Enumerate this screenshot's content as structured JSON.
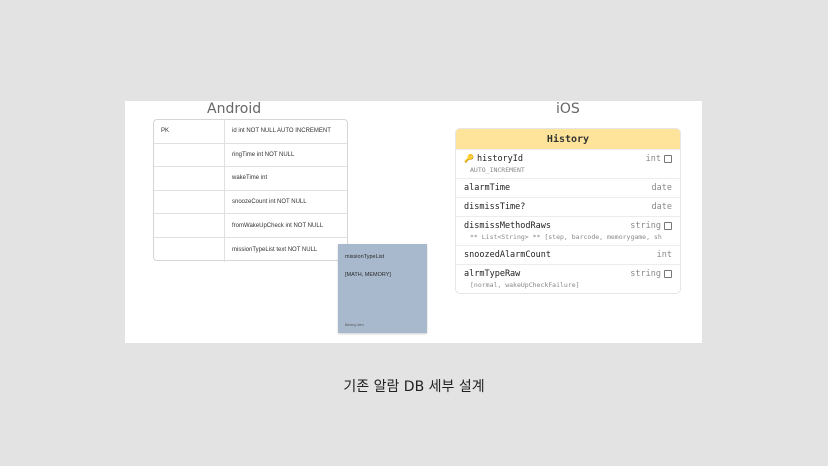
{
  "slide": {
    "android_heading": "Android",
    "ios_heading": "iOS"
  },
  "android_table": {
    "rows": [
      {
        "key": "PK",
        "value": "id int NOT NULL AUTO INCREMENT"
      },
      {
        "key": "",
        "value": "ringTime int NOT NULL"
      },
      {
        "key": "",
        "value": "wakeTime int"
      },
      {
        "key": "",
        "value": "snoozeCount int NOT NULL"
      },
      {
        "key": "",
        "value": "fromWakeUpCheck int NOT NULL"
      },
      {
        "key": "",
        "value": "missionTypeList text NOT NULL"
      }
    ]
  },
  "sticky_note": {
    "line1": "missionTypeList",
    "line2": "[MATH, MEMORY]",
    "author": "Benny kim"
  },
  "ios_entity": {
    "title": "History",
    "attributes": [
      {
        "name": "historyId",
        "type": "int",
        "note": "AUTO_INCREMENT",
        "icon": "key-icon",
        "optional_marker": true
      },
      {
        "name": "alarmTime",
        "type": "date",
        "note": ""
      },
      {
        "name": "dismissTime?",
        "type": "date",
        "note": ""
      },
      {
        "name": "dismissMethodRaws",
        "type": "string",
        "note": "** List<String> ** [step, barcode, memorygame, sh",
        "optional_marker": true
      },
      {
        "name": "snoozedAlarmCount",
        "type": "int",
        "note": ""
      },
      {
        "name": "alrmTypeRaw",
        "type": "string",
        "note": "[normal, wakeUpCheckFailure]",
        "optional_marker": true
      }
    ]
  },
  "caption": "기존 알람 DB 세부 설계",
  "colors": {
    "background": "#e3e3e3",
    "entity_header": "#fde49a",
    "sticky_note": "#a8b9cd"
  }
}
